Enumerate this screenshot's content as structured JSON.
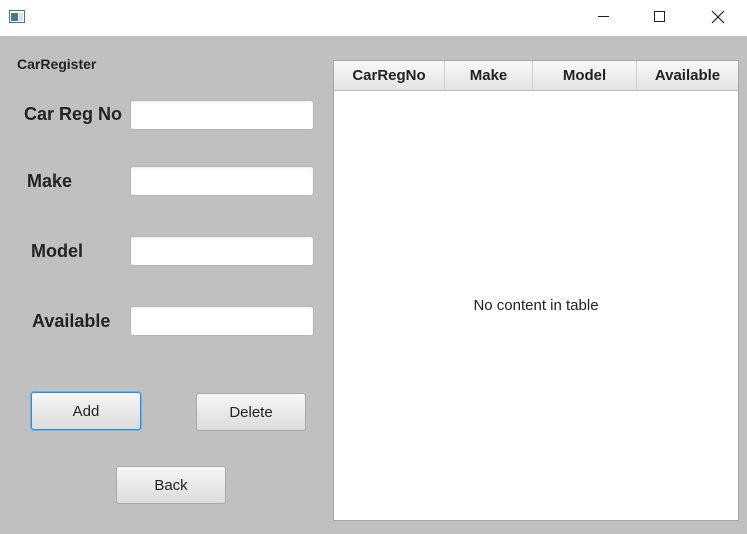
{
  "window": {
    "icon": "java-app-icon",
    "controls": [
      "minimize-icon",
      "maximize-icon",
      "close-icon"
    ]
  },
  "form": {
    "title": "CarRegister",
    "fields": {
      "car_reg_no": {
        "label": "Car Reg No",
        "value": "",
        "placeholder": ""
      },
      "make": {
        "label": "Make",
        "value": "",
        "placeholder": ""
      },
      "model": {
        "label": "Model",
        "value": "",
        "placeholder": ""
      },
      "available": {
        "label": "Available",
        "value": "",
        "placeholder": ""
      }
    },
    "buttons": {
      "add": "Add",
      "delete": "Delete",
      "back": "Back"
    }
  },
  "table": {
    "columns": [
      "CarRegNo",
      "Make",
      "Model",
      "Available"
    ],
    "rows": [],
    "placeholder": "No content in table"
  },
  "colors": {
    "client_background": "#c0c0c0",
    "focus_ring": "#2f8fd0",
    "table_background": "#ffffff"
  }
}
